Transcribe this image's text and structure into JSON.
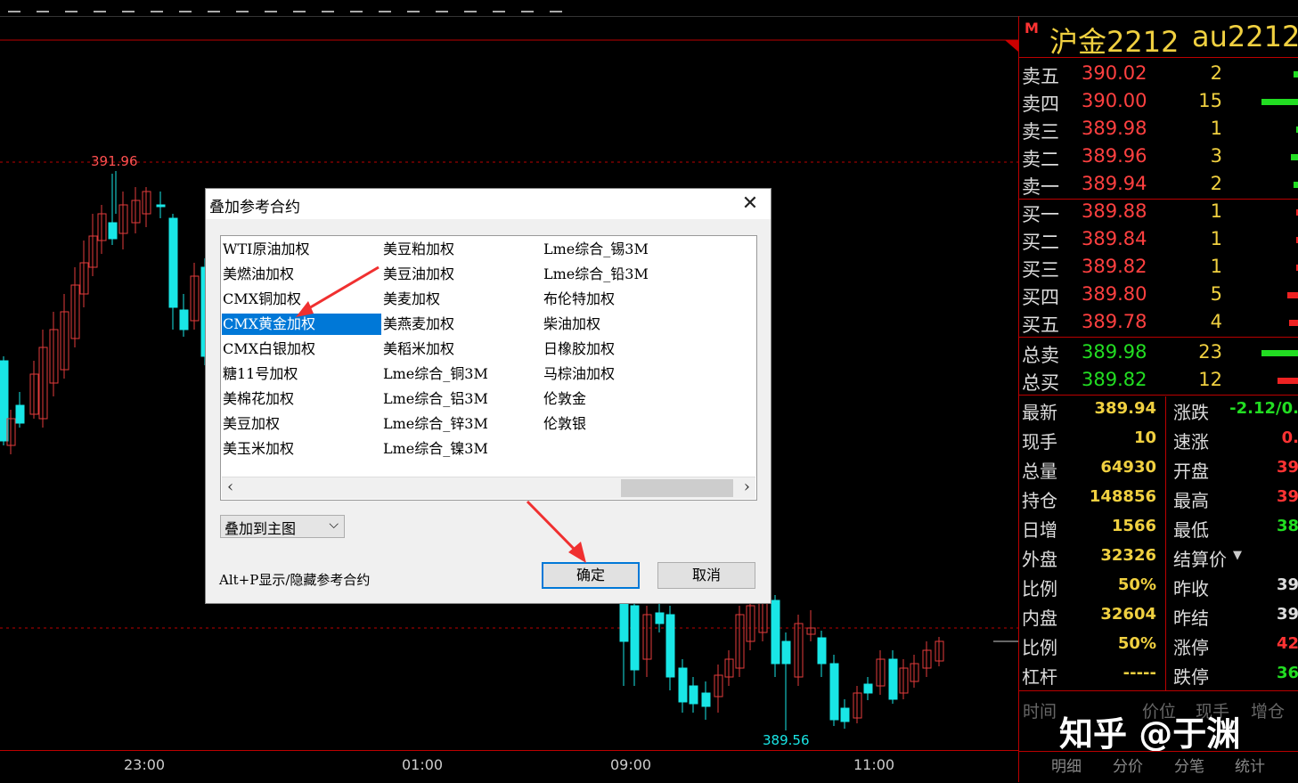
{
  "chart": {
    "high_label": "391.96",
    "low_label": "389.56",
    "time_labels": [
      "23:00",
      "01:00",
      "09:00",
      "11:00"
    ],
    "up_color": "#e33b3b",
    "down_color": "#19e6e6"
  },
  "quote": {
    "flag": "M",
    "name": "沪金2212",
    "code": "au2212",
    "asks": [
      {
        "label": "卖五",
        "price": "390.02",
        "vol": "2",
        "bar": 0.1
      },
      {
        "label": "卖四",
        "price": "390.00",
        "vol": "15",
        "bar": 0.7
      },
      {
        "label": "卖三",
        "price": "389.98",
        "vol": "1",
        "bar": 0.05
      },
      {
        "label": "卖二",
        "price": "389.96",
        "vol": "3",
        "bar": 0.15
      },
      {
        "label": "卖一",
        "price": "389.94",
        "vol": "2",
        "bar": 0.1
      }
    ],
    "bids": [
      {
        "label": "买一",
        "price": "389.88",
        "vol": "1",
        "bar": 0.05
      },
      {
        "label": "买二",
        "price": "389.84",
        "vol": "1",
        "bar": 0.05
      },
      {
        "label": "买三",
        "price": "389.82",
        "vol": "1",
        "bar": 0.05
      },
      {
        "label": "买四",
        "price": "389.80",
        "vol": "5",
        "bar": 0.22
      },
      {
        "label": "买五",
        "price": "389.78",
        "vol": "4",
        "bar": 0.18
      }
    ],
    "total_sell": {
      "label": "总卖",
      "price": "389.98",
      "vol": "23",
      "bar": 0.7
    },
    "total_buy": {
      "label": "总买",
      "price": "389.82",
      "vol": "12",
      "bar": 0.4
    },
    "stats": [
      {
        "l1": "最新",
        "v1": "389.94",
        "l2": "涨跌",
        "v2": "-2.12/0.",
        "c2": "#22dd22"
      },
      {
        "l1": "现手",
        "v1": "10",
        "l2": "速涨",
        "v2": "0.",
        "c2": "#ff3333"
      },
      {
        "l1": "总量",
        "v1": "64930",
        "l2": "开盘",
        "v2": "39",
        "c2": "#ff3333"
      },
      {
        "l1": "持仓",
        "v1": "148856",
        "l2": "最高",
        "v2": "39",
        "c2": "#ff3333"
      },
      {
        "l1": "日增",
        "v1": "1566",
        "l2": "最低",
        "v2": "38",
        "c2": "#22dd22"
      },
      {
        "l1": "外盘",
        "v1": "32326",
        "l2": "结算价",
        "v2": "",
        "c2": "#ddd"
      },
      {
        "l1": "比例",
        "v1": "50%",
        "l2": "昨收",
        "v2": "39",
        "c2": "#ddd"
      },
      {
        "l1": "内盘",
        "v1": "32604",
        "l2": "昨结",
        "v2": "39",
        "c2": "#ddd"
      },
      {
        "l1": "比例",
        "v1": "50%",
        "l2": "涨停",
        "v2": "42",
        "c2": "#ff3333"
      },
      {
        "l1": "杠杆",
        "v1": "-----",
        "l2": "跌停",
        "v2": "36",
        "c2": "#22dd22"
      }
    ],
    "tick_headers": [
      "时间",
      "价位",
      "现手",
      "增仓"
    ],
    "watermark": "知乎 @于渊",
    "tabs": [
      "明细",
      "分价",
      "分笔",
      "统计"
    ]
  },
  "dialog": {
    "title": "叠加参考合约",
    "columns": [
      [
        "WTI原油加权",
        "美燃油加权",
        "CMX铜加权",
        "CMX黄金加权",
        "CMX白银加权",
        "糖11号加权",
        "美棉花加权",
        "美豆加权",
        "美玉米加权"
      ],
      [
        "美豆粕加权",
        "美豆油加权",
        "美麦加权",
        "美燕麦加权",
        "美稻米加权",
        "Lme综合_铜3M",
        "Lme综合_铝3M",
        "Lme综合_锌3M",
        "Lme综合_镍3M"
      ],
      [
        "Lme综合_锡3M",
        "Lme综合_铅3M",
        "布伦特加权",
        "柴油加权",
        "日橡胶加权",
        "马棕油加权",
        "伦敦金",
        "伦敦银"
      ]
    ],
    "selected": "CMX黄金加权",
    "overlay_mode": "叠加到主图",
    "hint": "Alt+P显示/隐藏参考合约",
    "ok_label": "确定",
    "cancel_label": "取消"
  }
}
